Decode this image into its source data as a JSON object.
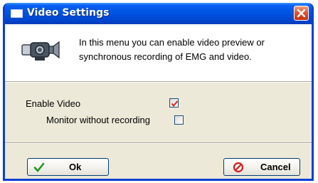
{
  "window": {
    "title": "Video Settings",
    "title_icon": "window-icon",
    "close_icon": "close-icon",
    "accent_color": "#0054e3",
    "close_color": "#e2572f"
  },
  "info": {
    "icon": "camera-icon",
    "line1": "In this menu you can enable video preview or",
    "line2": "synchronous recording of EMG and video."
  },
  "options": {
    "enable_video": {
      "label": "Enable Video",
      "checked": true
    },
    "monitor_without_recording": {
      "label": "Monitor without recording",
      "checked": false
    }
  },
  "buttons": {
    "ok": {
      "label": "Ok",
      "icon": "checkmark-icon",
      "icon_color": "#1c9a1c"
    },
    "cancel": {
      "label": "Cancel",
      "icon": "cancel-icon",
      "icon_color": "#d42020"
    }
  }
}
